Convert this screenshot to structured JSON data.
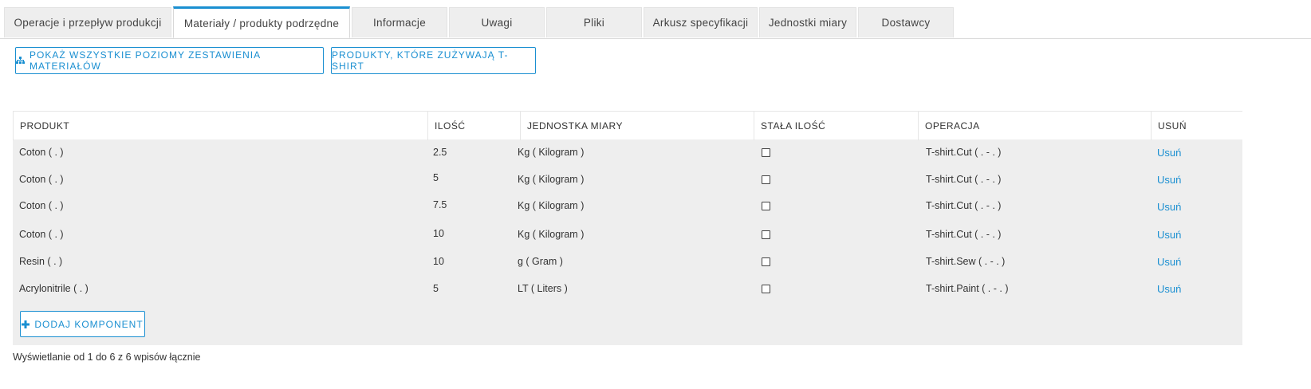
{
  "tabs": [
    {
      "label": "Operacje i przepływ produkcji",
      "active": false
    },
    {
      "label": "Materiały / produkty podrzędne",
      "active": true
    },
    {
      "label": "Informacje",
      "active": false
    },
    {
      "label": "Uwagi",
      "active": false
    },
    {
      "label": "Pliki",
      "active": false
    },
    {
      "label": "Arkusz specyfikacji",
      "active": false
    },
    {
      "label": "Jednostki miary",
      "active": false
    },
    {
      "label": "Dostawcy",
      "active": false
    }
  ],
  "actions": {
    "show_levels_label": "POKAŻ WSZYSTKIE POZIOMY ZESTAWIENIA MATERIAŁÓW",
    "show_levels_icon": "sitemap-icon",
    "products_using_label": "PRODUKTY, KTÓRE ZUŻYWAJĄ T-SHIRT"
  },
  "table": {
    "columns": [
      "PRODUKT",
      "ILOŚĆ",
      "JEDNOSTKA MIARY",
      "STAŁA ILOŚĆ",
      "OPERACJA",
      "USUŃ"
    ],
    "rows": [
      {
        "product": "Coton ( . )",
        "qty": "2.5",
        "uom": "Kg ( Kilogram )",
        "fixed": false,
        "operation": "T-shirt.Cut ( . - . )",
        "delete": "Usuń"
      },
      {
        "product": "Coton ( . )",
        "qty": "5",
        "uom": "Kg ( Kilogram )",
        "fixed": false,
        "operation": "T-shirt.Cut ( . - . )",
        "delete": "Usuń"
      },
      {
        "product": "Coton ( . )",
        "qty": "7.5",
        "uom": "Kg ( Kilogram )",
        "fixed": false,
        "operation": "T-shirt.Cut ( . - . )",
        "delete": "Usuń"
      },
      {
        "product": "Coton ( . )",
        "qty": "10",
        "uom": "Kg ( Kilogram )",
        "fixed": false,
        "operation": "T-shirt.Cut ( . - . )",
        "delete": "Usuń"
      },
      {
        "product": "Resin ( . )",
        "qty": "10",
        "uom": "g ( Gram )",
        "fixed": false,
        "operation": "T-shirt.Sew ( . - . )",
        "delete": "Usuń"
      },
      {
        "product": "Acrylonitrile ( . )",
        "qty": "5",
        "uom": "LT ( Liters )",
        "fixed": false,
        "operation": "T-shirt.Paint ( . - . )",
        "delete": "Usuń"
      }
    ],
    "add_label": "DODAJ KOMPONENT"
  },
  "footer": {
    "info": "Wyświetlanie od 1 do 6 z 6 wpisów łącznie"
  },
  "colors": {
    "accent": "#1a8fd1",
    "grid_bg": "#eeeeee"
  }
}
